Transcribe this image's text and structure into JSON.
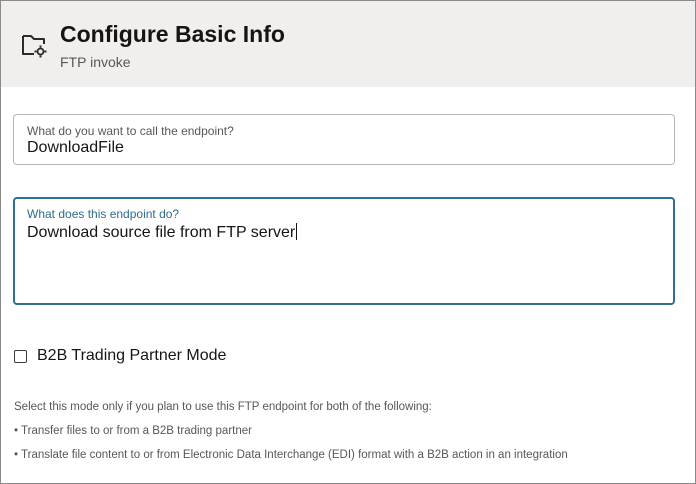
{
  "header": {
    "title": "Configure Basic Info",
    "subtitle": "FTP invoke",
    "icon": "folder-gear-icon"
  },
  "endpoint_name": {
    "label": "What do you want to call the endpoint?",
    "value": "DownloadFile"
  },
  "endpoint_description": {
    "label": "What does this endpoint do?",
    "value": "Download source file from FTP server"
  },
  "b2b_mode": {
    "label": "B2B Trading Partner Mode",
    "checked": false
  },
  "help": {
    "intro": "Select this mode only if you plan to use this FTP endpoint for both of the following:",
    "items": [
      "• Transfer files to or from a B2B trading partner",
      "• Translate file content to or from Electronic Data Interchange (EDI) format with a B2B action in an integration"
    ]
  },
  "colors": {
    "header_background": "#f1efed",
    "focus_border": "#2f6f8f",
    "focus_label": "#2b6d8c"
  }
}
